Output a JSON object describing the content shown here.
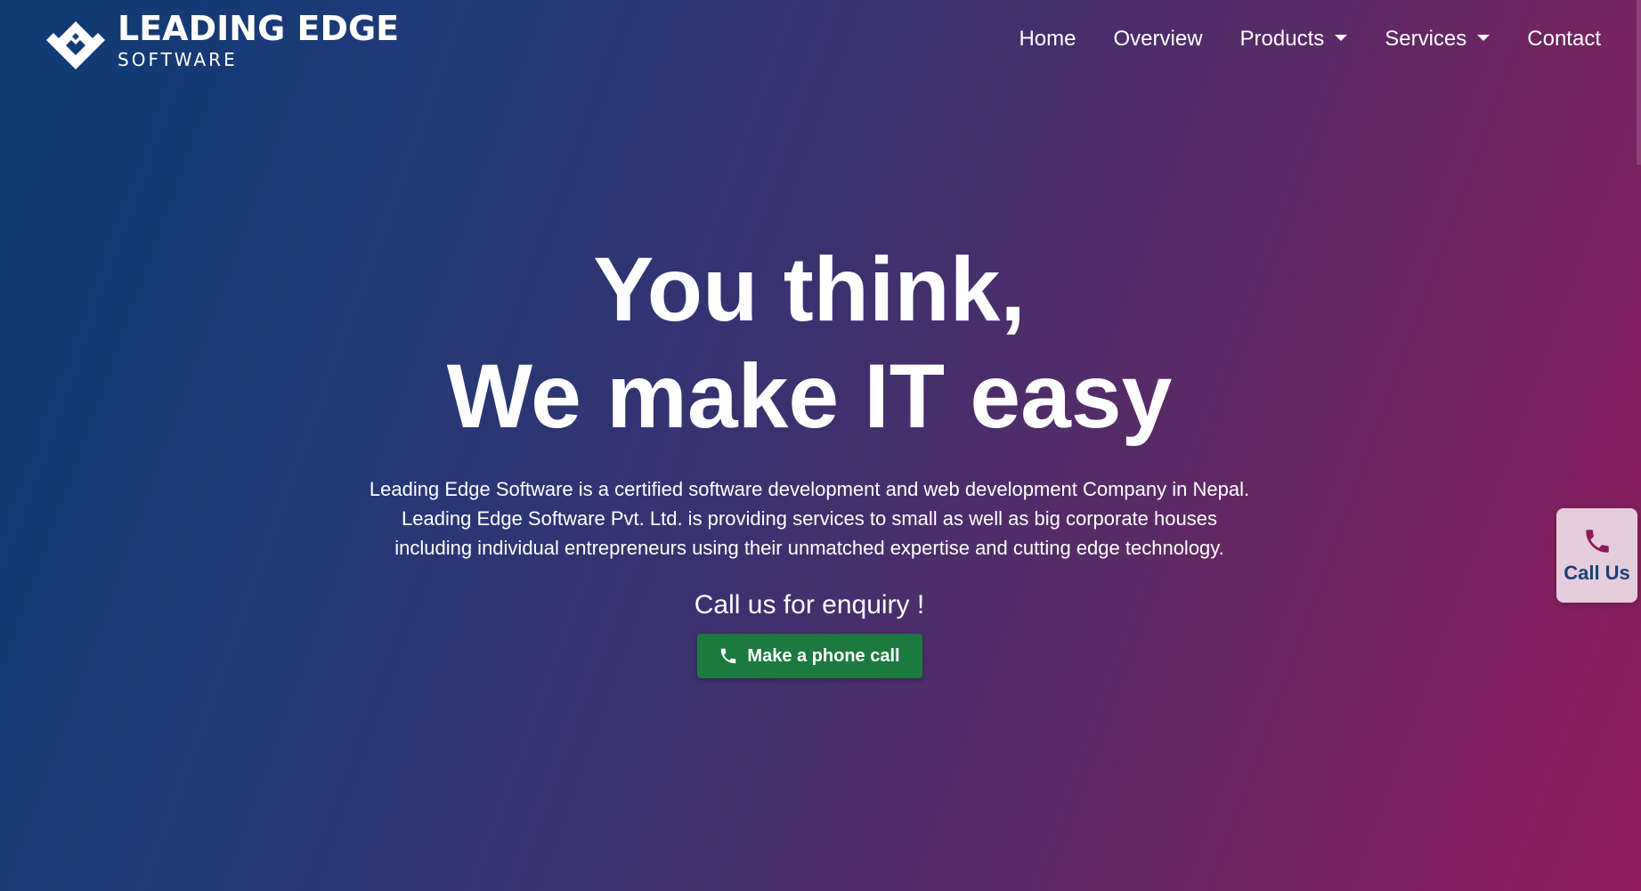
{
  "brand": {
    "name": "LEADING EDGE",
    "sub": "SOFTWARE",
    "logo_icon": "diamond-logo-icon"
  },
  "nav": {
    "items": [
      {
        "label": "Home",
        "dropdown": false
      },
      {
        "label": "Overview",
        "dropdown": false
      },
      {
        "label": "Products",
        "dropdown": true
      },
      {
        "label": "Services",
        "dropdown": true
      },
      {
        "label": "Contact",
        "dropdown": false
      }
    ]
  },
  "hero": {
    "headline_line1": "You think,",
    "headline_line2": "We make IT easy",
    "description": "Leading Edge Software is a certified software development and web development Company in Nepal. Leading Edge Software Pvt. Ltd. is providing services to small as well as big corporate houses including individual entrepreneurs using their unmatched expertise and cutting edge technology.",
    "enquiry_text": "Call us for enquiry !",
    "button_label": "Make a phone call",
    "button_icon": "phone-icon"
  },
  "float_call": {
    "label": "Call Us",
    "icon": "phone-icon"
  },
  "colors": {
    "gradient_start": "#0d3b72",
    "gradient_end": "#8e1c5a",
    "button_green": "#1c7a3f",
    "float_label": "#1a3f77",
    "float_icon": "#8e1c5a"
  }
}
